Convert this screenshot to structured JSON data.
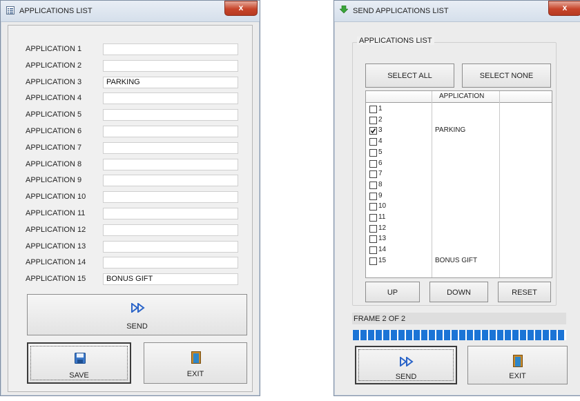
{
  "left_window": {
    "title": "APPLICATIONS LIST",
    "close_label": "x",
    "rows": [
      {
        "label": "APPLICATION 1",
        "value": ""
      },
      {
        "label": "APPLICATION 2",
        "value": ""
      },
      {
        "label": "APPLICATION 3",
        "value": "PARKING"
      },
      {
        "label": "APPLICATION 4",
        "value": ""
      },
      {
        "label": "APPLICATION 5",
        "value": ""
      },
      {
        "label": "APPLICATION 6",
        "value": ""
      },
      {
        "label": "APPLICATION 7",
        "value": ""
      },
      {
        "label": "APPLICATION 8",
        "value": ""
      },
      {
        "label": "APPLICATION 9",
        "value": ""
      },
      {
        "label": "APPLICATION 10",
        "value": ""
      },
      {
        "label": "APPLICATION 11",
        "value": ""
      },
      {
        "label": "APPLICATION 12",
        "value": ""
      },
      {
        "label": "APPLICATION 13",
        "value": ""
      },
      {
        "label": "APPLICATION 14",
        "value": ""
      },
      {
        "label": "APPLICATION 15",
        "value": "BONUS GIFT"
      }
    ],
    "send_label": "SEND",
    "save_label": "SAVE",
    "exit_label": "EXIT"
  },
  "right_window": {
    "title": "SEND APPLICATIONS LIST",
    "close_label": "x",
    "group_label": "APPLICATIONS LIST",
    "select_all_label": "SELECT ALL",
    "select_none_label": "SELECT NONE",
    "grid_header": "APPLICATION",
    "grid_rows": [
      {
        "num": "1",
        "app": "",
        "checked": false
      },
      {
        "num": "2",
        "app": "",
        "checked": false
      },
      {
        "num": "3",
        "app": "PARKING",
        "checked": true
      },
      {
        "num": "4",
        "app": "",
        "checked": false
      },
      {
        "num": "5",
        "app": "",
        "checked": false
      },
      {
        "num": "6",
        "app": "",
        "checked": false
      },
      {
        "num": "7",
        "app": "",
        "checked": false
      },
      {
        "num": "8",
        "app": "",
        "checked": false
      },
      {
        "num": "9",
        "app": "",
        "checked": false
      },
      {
        "num": "10",
        "app": "",
        "checked": false
      },
      {
        "num": "11",
        "app": "",
        "checked": false
      },
      {
        "num": "12",
        "app": "",
        "checked": false
      },
      {
        "num": "13",
        "app": "",
        "checked": false
      },
      {
        "num": "14",
        "app": "",
        "checked": false
      },
      {
        "num": "15",
        "app": "BONUS GIFT",
        "checked": false
      }
    ],
    "up_label": "UP",
    "down_label": "DOWN",
    "reset_label": "RESET",
    "frame_status": "FRAME 2 OF 2",
    "progress_fraction": 1.0,
    "send_label": "SEND",
    "exit_label": "EXIT"
  },
  "colors": {
    "progress": "#1b74d6",
    "play_icon": "#2a64c8",
    "save_icon": "#3c78c8",
    "exit_icon": "#c8892a",
    "close": "#c7452b"
  },
  "icons": {
    "list": "list-icon",
    "download": "download-icon",
    "send": "fast-forward-icon",
    "save": "floppy-disk-icon",
    "exit": "door-icon"
  }
}
